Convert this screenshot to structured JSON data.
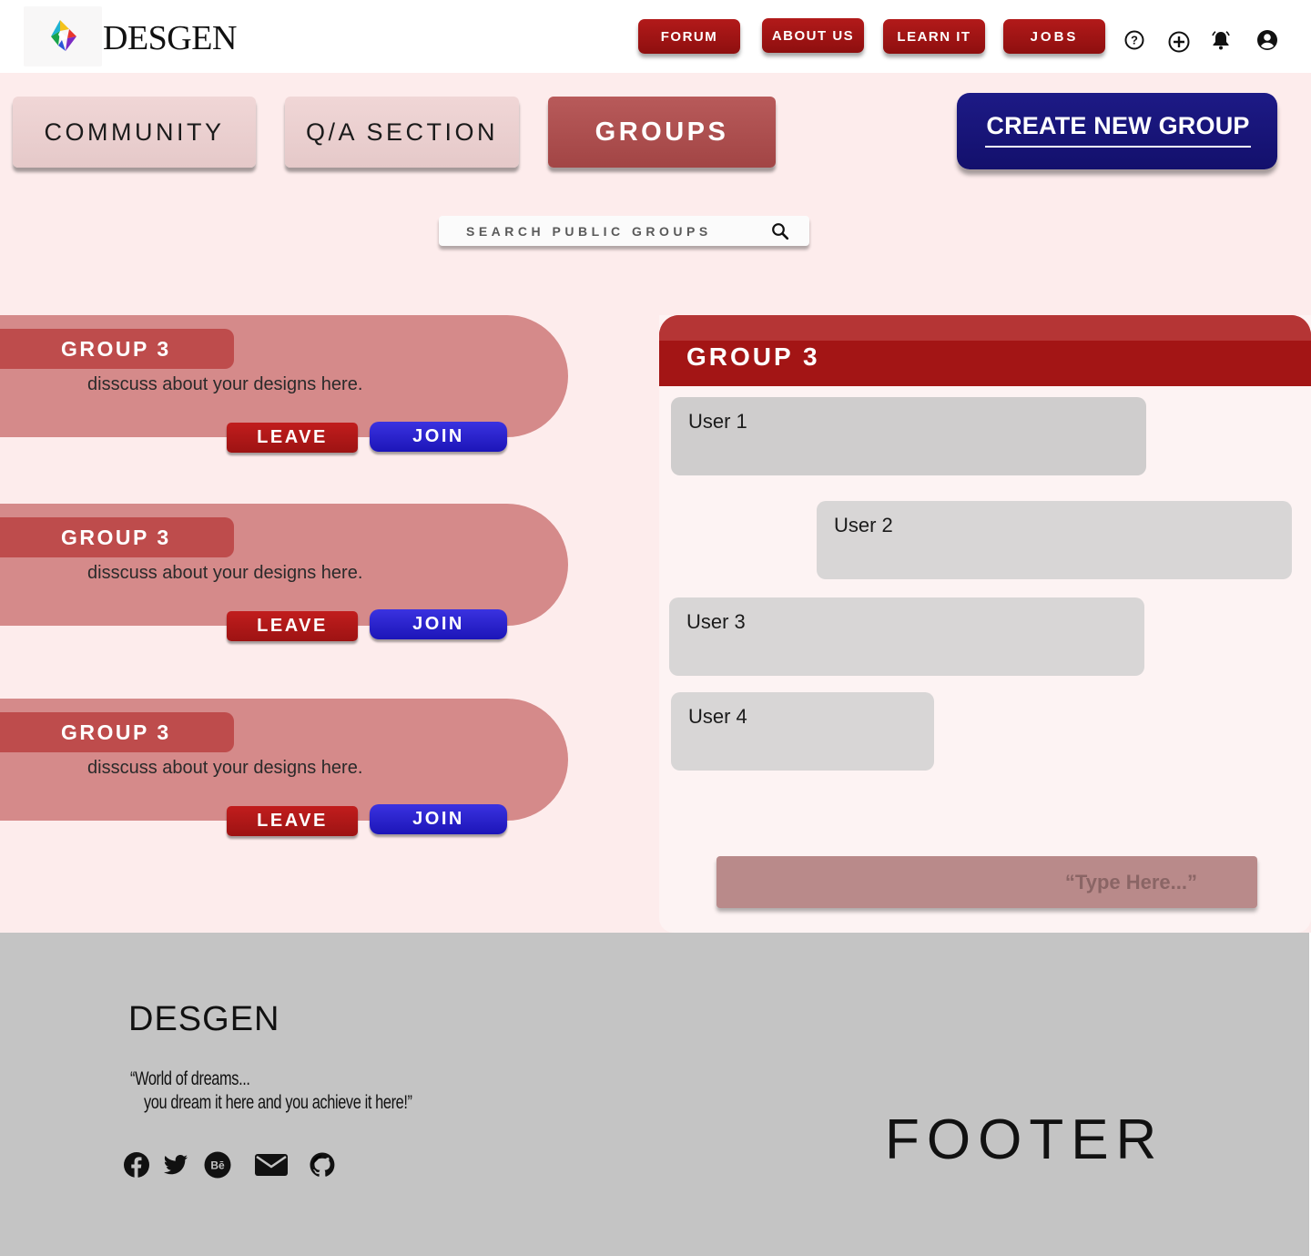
{
  "header": {
    "brand": "DESGEN",
    "nav": [
      "FORUM",
      "ABOUT US",
      "LEARN IT",
      "JOBS"
    ],
    "icons": [
      "help-icon",
      "add-icon",
      "notification-bell-icon",
      "account-icon"
    ]
  },
  "tabs": {
    "community": "COMMUNITY",
    "qa": "Q/A SECTION",
    "groups": "GROUPS"
  },
  "create_group_label": "CREATE NEW GROUP",
  "search": {
    "placeholder": "SEARCH PUBLIC GROUPS"
  },
  "groups": [
    {
      "title": "GROUP 3",
      "description": "disscuss about your designs here.",
      "leave": "LEAVE",
      "join": "JOIN"
    },
    {
      "title": "GROUP 3",
      "description": "disscuss about your designs here.",
      "leave": "LEAVE",
      "join": "JOIN"
    },
    {
      "title": "GROUP 3",
      "description": "disscuss about your designs here.",
      "leave": "LEAVE",
      "join": "JOIN"
    }
  ],
  "chat": {
    "title": "GROUP 3",
    "messages": [
      "User 1",
      "User 2",
      "User 3",
      "User 4"
    ],
    "input_placeholder": "“Type Here...”"
  },
  "footer": {
    "brand": "DESGEN",
    "quote_line1": "“World of dreams...",
    "quote_line2": "you dream it here and you achieve it here!”",
    "label": "FOOTER",
    "social": [
      "facebook-icon",
      "twitter-icon",
      "behance-icon",
      "mail-icon",
      "github-icon"
    ]
  },
  "colors": {
    "nav_red": "#a31515",
    "create_blue": "#1d1a86",
    "main_bg": "#fdecec",
    "footer_bg": "#c4c4c4"
  }
}
